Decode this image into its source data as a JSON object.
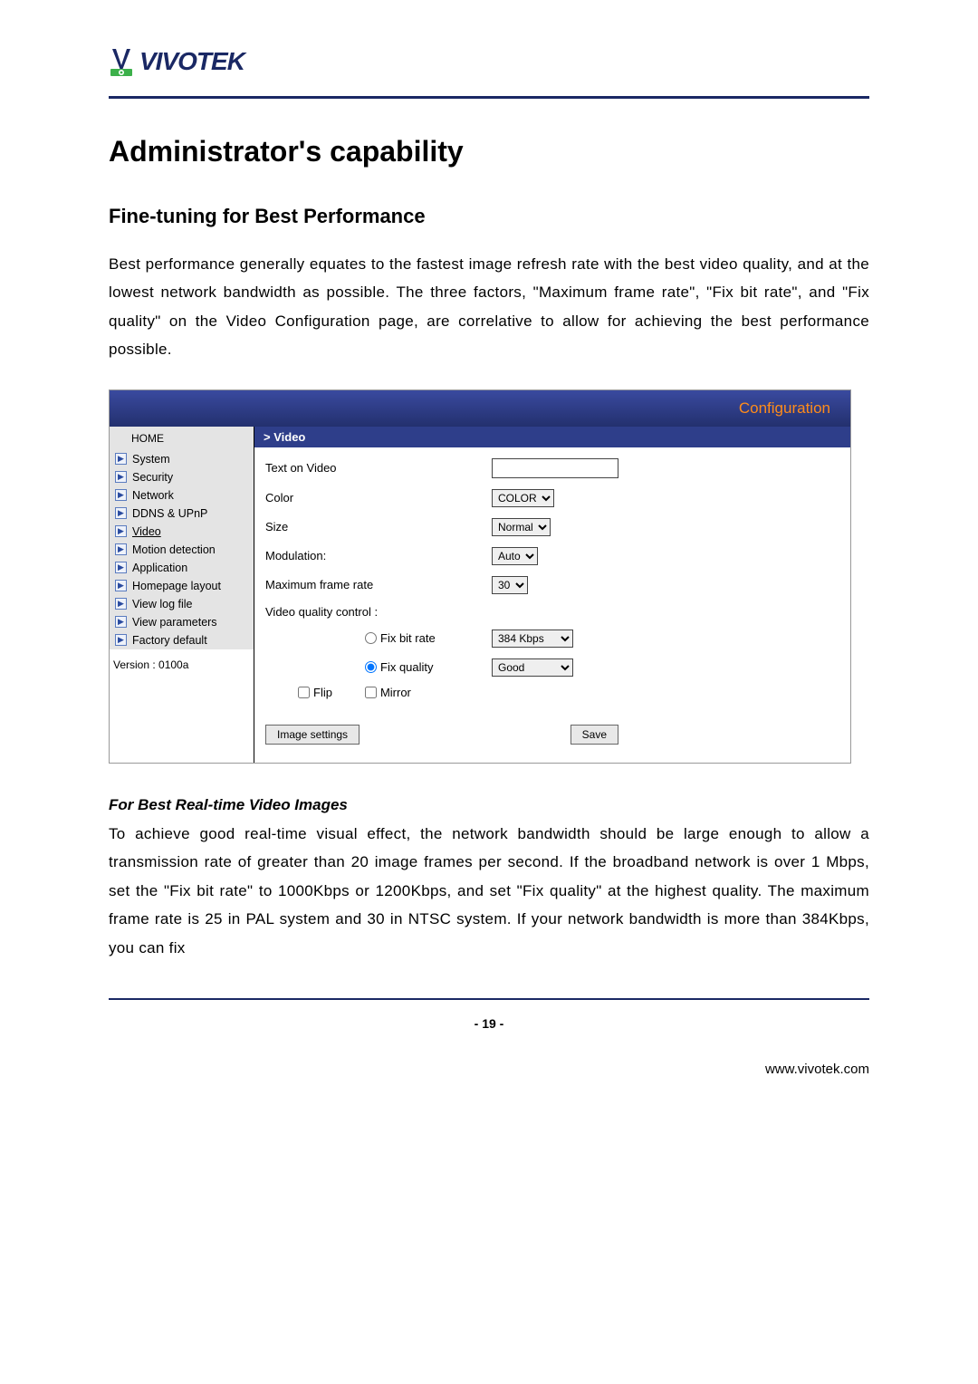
{
  "logo": {
    "brand": "VIVOTEK"
  },
  "heading": "Administrator's capability",
  "subheading": "Fine-tuning for Best Performance",
  "intro": "Best performance generally equates to the fastest image refresh rate with the best video quality, and at the lowest network bandwidth as possible. The three factors, \"Maximum frame rate\", \"Fix bit rate\", and \"Fix quality\" on the Video Configuration page, are correlative to allow for achieving the best performance possible.",
  "config": {
    "header": "Configuration",
    "section": "> Video",
    "sidebar": {
      "home": "HOME",
      "items": [
        "System",
        "Security",
        "Network",
        "DDNS & UPnP",
        "Video",
        "Motion detection",
        "Application",
        "Homepage layout",
        "View log file",
        "View parameters",
        "Factory default"
      ],
      "current_index": 4,
      "version": "Version : 0100a"
    },
    "form": {
      "text_on_video": "Text on Video",
      "color_label": "Color",
      "color_value": "COLOR",
      "size_label": "Size",
      "size_value": "Normal",
      "modulation_label": "Modulation:",
      "modulation_value": "Auto",
      "max_frame_label": "Maximum frame rate",
      "max_frame_value": "30",
      "vqc_label": "Video quality control :",
      "fix_bitrate_label": "Fix bit rate",
      "fix_bitrate_value": "384 Kbps",
      "fix_quality_label": "Fix quality",
      "fix_quality_value": "Good",
      "flip": "Flip",
      "mirror": "Mirror",
      "image_settings_btn": "Image settings",
      "save_btn": "Save"
    }
  },
  "sub2": "For Best Real-time Video Images",
  "body2": "To achieve good real-time visual effect, the network bandwidth should be large enough to allow a transmission rate of greater than 20 image frames per second. If the broadband network is over 1 Mbps, set the \"Fix bit rate\" to 1000Kbps or 1200Kbps, and set \"Fix quality\" at the highest quality. The maximum frame rate is 25 in PAL system and 30 in NTSC system. If your network bandwidth is more than 384Kbps, you can fix",
  "page_number": "- 19 -",
  "footer_url": "www.vivotek.com"
}
